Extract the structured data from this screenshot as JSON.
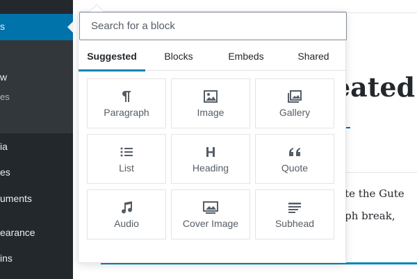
{
  "sidebar": {
    "items": [
      {
        "label": "s"
      },
      {
        "label": "w"
      },
      {
        "label": "es"
      },
      {
        "label": "ia"
      },
      {
        "label": "es"
      },
      {
        "label": "uments"
      },
      {
        "label": "earance"
      },
      {
        "label": "ins"
      }
    ]
  },
  "editor": {
    "title_fragment": "eated",
    "body_line_1": "rate the Gute",
    "body_line_2": "raph break,"
  },
  "inserter": {
    "search_placeholder": "Search for a block",
    "tabs": [
      "Suggested",
      "Blocks",
      "Embeds",
      "Shared"
    ],
    "selected_tab": "Suggested",
    "blocks": [
      {
        "label": "Paragraph",
        "icon": "paragraph-icon"
      },
      {
        "label": "Image",
        "icon": "image-icon"
      },
      {
        "label": "Gallery",
        "icon": "gallery-icon"
      },
      {
        "label": "List",
        "icon": "list-icon"
      },
      {
        "label": "Heading",
        "icon": "heading-icon"
      },
      {
        "label": "Quote",
        "icon": "quote-icon"
      },
      {
        "label": "Audio",
        "icon": "audio-icon"
      },
      {
        "label": "Cover Image",
        "icon": "cover-image-icon"
      },
      {
        "label": "Subhead",
        "icon": "subhead-icon"
      }
    ]
  },
  "colors": {
    "admin_sidebar": "#23282d",
    "admin_active": "#0073aa",
    "tab_underline": "#0085ba",
    "icon_gray": "#555d66"
  }
}
